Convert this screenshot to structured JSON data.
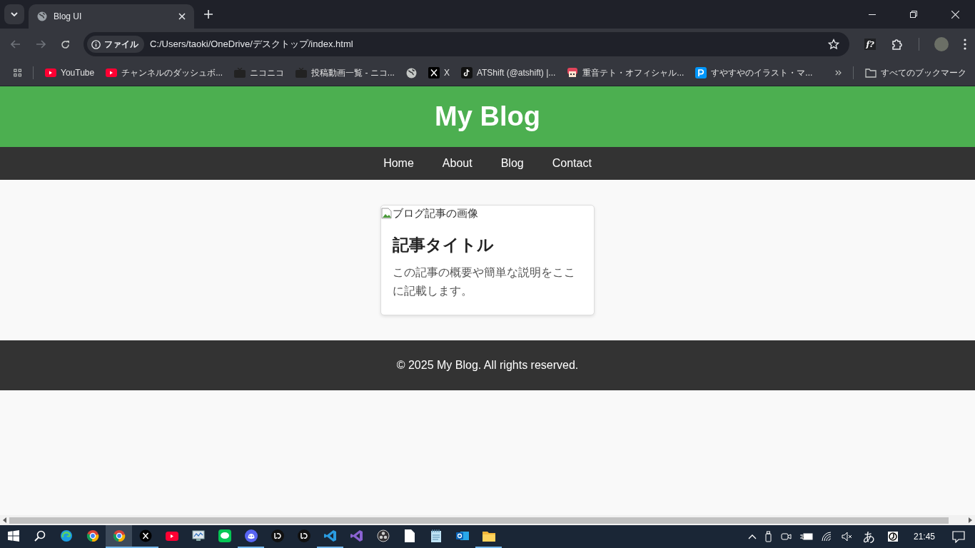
{
  "browser": {
    "tab": {
      "title": "Blog UI"
    },
    "extension_label": "f?",
    "address": {
      "chip": "ファイル",
      "url": "C:/Users/taoki/OneDrive/デスクトップ/index.html"
    },
    "bookmarks": [
      {
        "kind": "youtube",
        "label": "YouTube"
      },
      {
        "kind": "youtube",
        "label": "チャンネルのダッシュボ..."
      },
      {
        "kind": "tv",
        "label": "ニコニコ"
      },
      {
        "kind": "tv",
        "label": "投稿動画一覧 - ニコ..."
      },
      {
        "kind": "globe"
      },
      {
        "kind": "x",
        "label": "X"
      },
      {
        "kind": "tiktok",
        "label": "ATShift (@atshift) |..."
      },
      {
        "kind": "character",
        "label": "重音テト・オフィシャル..."
      },
      {
        "kind": "letter",
        "label": "すやすやのイラスト・マ..."
      }
    ],
    "all_bookmarks": "すべてのブックマーク"
  },
  "page": {
    "header": {
      "title": "My Blog"
    },
    "nav": [
      {
        "label": "Home"
      },
      {
        "label": "About"
      },
      {
        "label": "Blog"
      },
      {
        "label": "Contact"
      }
    ],
    "card": {
      "image_alt": "ブログ記事の画像",
      "title": "記事タイトル",
      "description": "この記事の概要や簡単な説明をここに記載します。"
    },
    "footer": "© 2025 My Blog. All rights reserved."
  },
  "taskbar": {
    "apps": [
      {
        "kind": "edge",
        "running": false,
        "selected": false
      },
      {
        "kind": "chrome",
        "running": false,
        "selected": false
      },
      {
        "kind": "chrome",
        "running": true,
        "selected": true
      },
      {
        "kind": "x",
        "running": true,
        "selected": false
      },
      {
        "kind": "youtube",
        "running": false,
        "selected": false
      },
      {
        "kind": "monitor",
        "running": false,
        "selected": false
      },
      {
        "kind": "chat",
        "running": false,
        "selected": false
      },
      {
        "kind": "discord",
        "running": true,
        "selected": false
      },
      {
        "kind": "yu",
        "running": false,
        "selected": false
      },
      {
        "kind": "yu",
        "running": false,
        "selected": false
      },
      {
        "kind": "code",
        "running": true,
        "selected": false
      },
      {
        "kind": "studio",
        "running": false,
        "selected": false
      },
      {
        "kind": "obs",
        "running": false,
        "selected": false
      },
      {
        "kind": "file",
        "running": false,
        "selected": false
      },
      {
        "kind": "notepad",
        "running": false,
        "selected": false
      },
      {
        "kind": "mail",
        "running": false,
        "selected": false
      },
      {
        "kind": "folder",
        "running": true,
        "selected": false
      }
    ],
    "ime": "あ",
    "clock": "21:45"
  }
}
